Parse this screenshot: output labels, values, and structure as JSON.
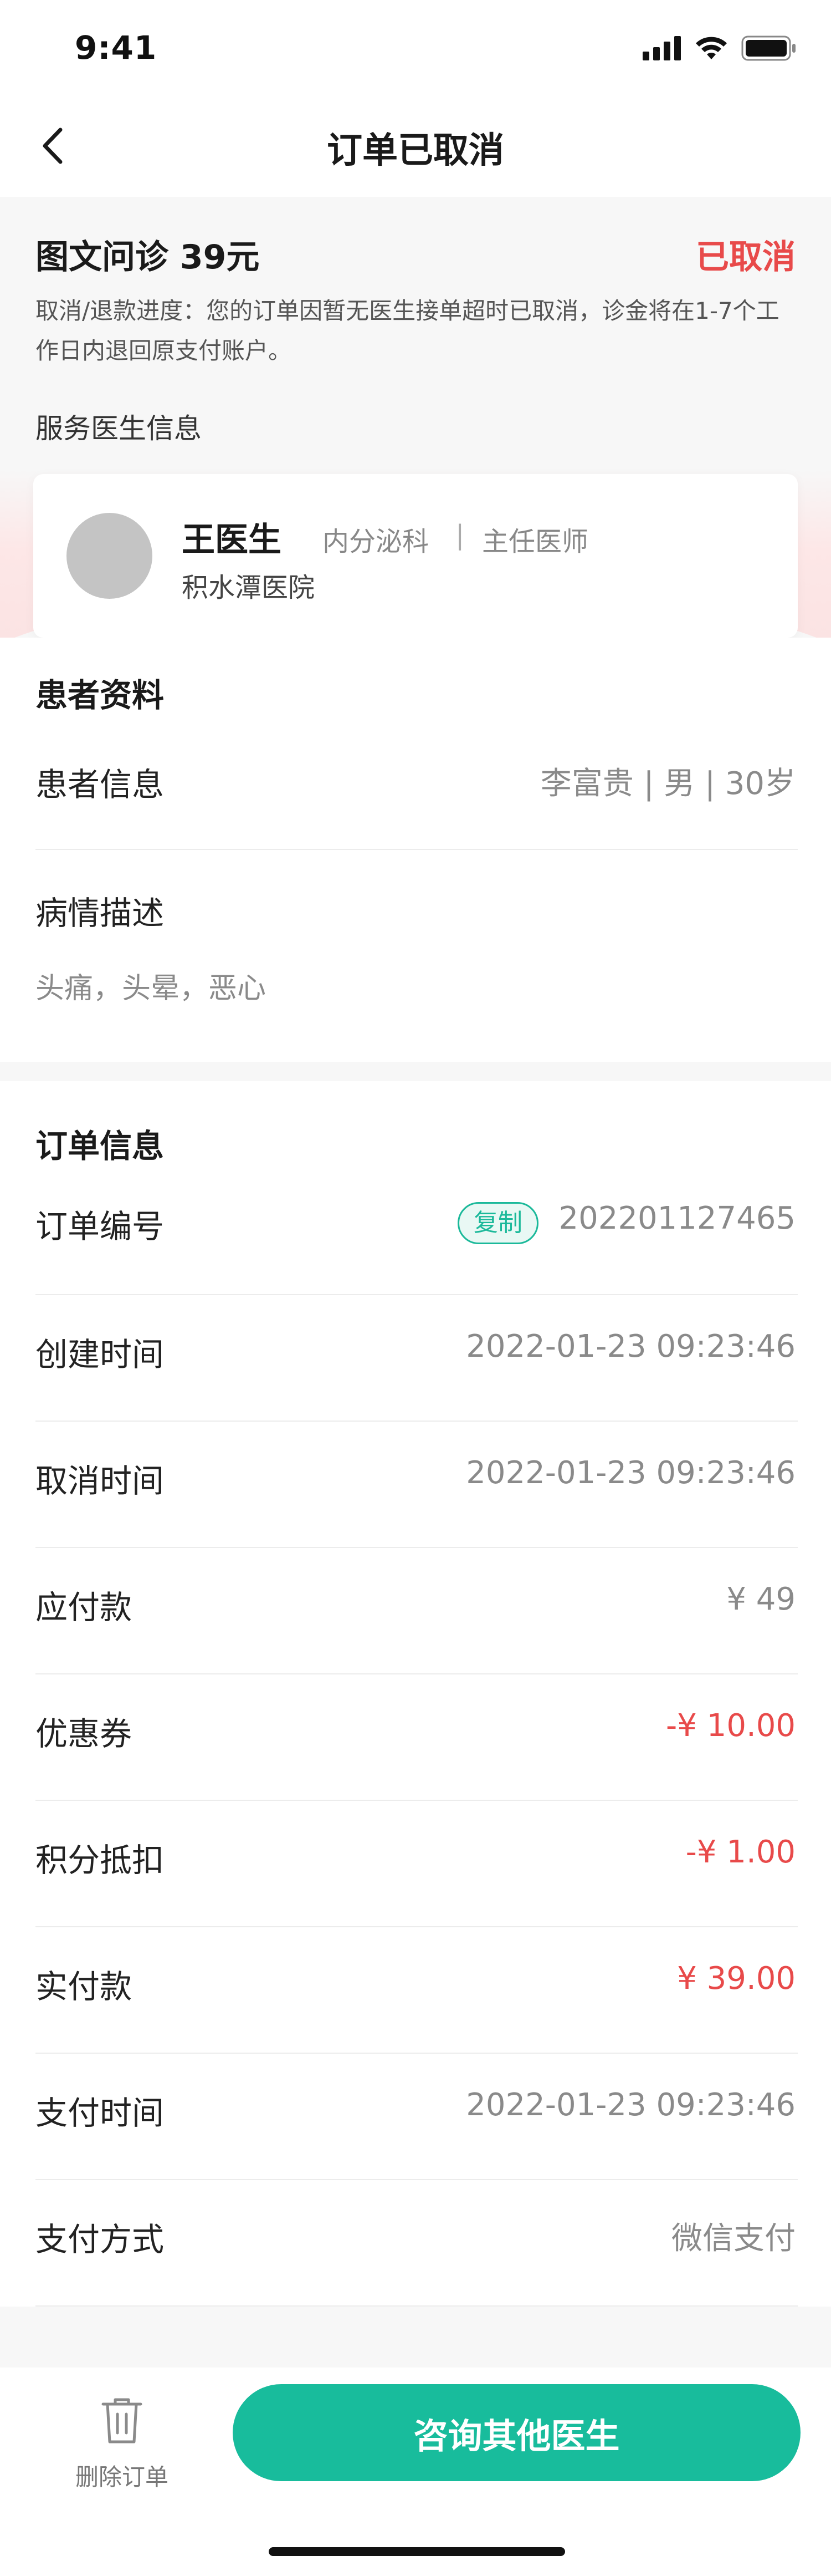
{
  "status_bar": {
    "time": "9:41"
  },
  "nav": {
    "title": "订单已取消",
    "back_icon": "chevron-left-icon"
  },
  "summary": {
    "service": "图文问诊 39元",
    "status": "已取消",
    "progress": "取消/退款进度：您的订单因暂无医生接单超时已取消，诊金将在1-7个工作日内退回原支付账户。",
    "doctor_section_label": "服务医生信息"
  },
  "doctor": {
    "name": "王医生",
    "department": "内分泌科",
    "separator": "|",
    "title": "主任医师",
    "hospital": "积水潭医院"
  },
  "patient": {
    "section_title": "患者资料",
    "info_label": "患者信息",
    "info_value": "李富贵 | 男 | 30岁",
    "condition_label": "病情描述",
    "condition_value": "头痛，头晕，恶心"
  },
  "order": {
    "section_title": "订单信息",
    "copy_label": "复制",
    "rows": [
      {
        "label": "订单编号",
        "value": "202201127465"
      },
      {
        "label": "创建时间",
        "value": "2022-01-23 09:23:46"
      },
      {
        "label": "取消时间",
        "value": "2022-01-23 09:23:46"
      },
      {
        "label": "应付款",
        "value": "¥ 49"
      },
      {
        "label": "优惠券",
        "value": "-¥ 10.00"
      },
      {
        "label": "积分抵扣",
        "value": "-¥ 1.00"
      },
      {
        "label": "实付款",
        "value": "¥ 39.00"
      },
      {
        "label": "支付时间",
        "value": "2022-01-23 09:23:46"
      },
      {
        "label": "支付方式",
        "value": "微信支付"
      }
    ]
  },
  "bottom": {
    "delete_label": "删除订单",
    "consult_label": "咨询其他医生"
  },
  "colors": {
    "accent": "#18bc9c",
    "danger": "#e84a4a",
    "muted": "#8a8a8a"
  }
}
